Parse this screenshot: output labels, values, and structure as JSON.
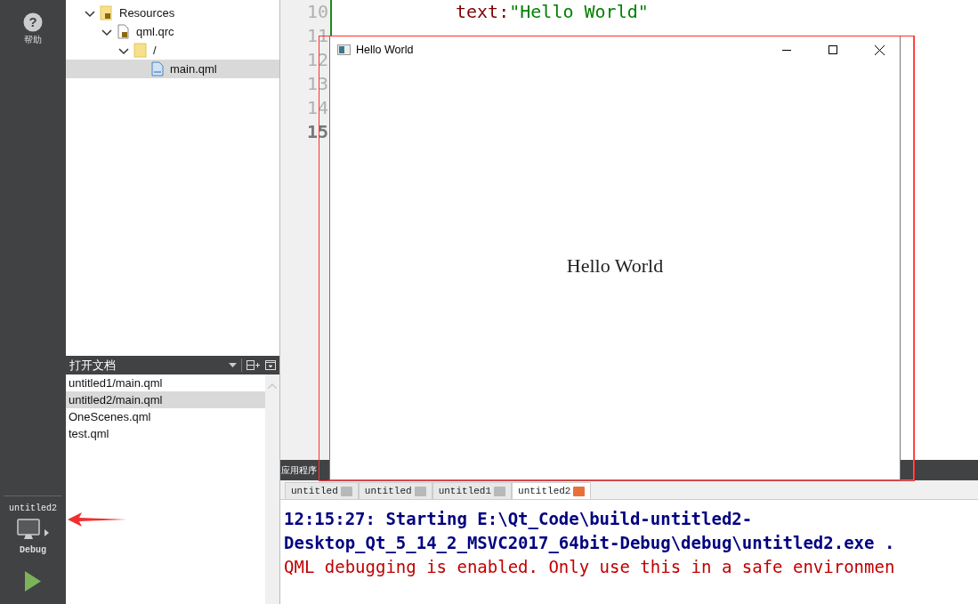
{
  "sidebar": {
    "help_icon": "?",
    "help_label": "帮助",
    "project": "untitled2",
    "build_config": "Debug"
  },
  "project_tree": [
    {
      "label": "Resources",
      "kind": "resfolder",
      "expanded": true,
      "selected": false,
      "children": [
        {
          "label": "qml.qrc",
          "kind": "qrc",
          "expanded": true,
          "selected": false,
          "children": [
            {
              "label": "/",
              "kind": "folder",
              "expanded": true,
              "selected": false,
              "children": [
                {
                  "label": "main.qml",
                  "kind": "qml",
                  "selected": true
                }
              ]
            }
          ]
        }
      ]
    }
  ],
  "open_documents": {
    "title": "打开文档",
    "items": [
      {
        "label": "untitled1/main.qml",
        "selected": false
      },
      {
        "label": "untitled2/main.qml",
        "selected": true
      },
      {
        "label": "OneScenes.qml",
        "selected": false
      },
      {
        "label": "test.qml",
        "selected": false
      }
    ]
  },
  "editor": {
    "lines": [
      {
        "number": "10",
        "current": false,
        "parts": [
          {
            "kind": "prop",
            "text": "text:"
          },
          {
            "kind": "string",
            "text": "\"Hello World\""
          }
        ]
      },
      {
        "number": "11",
        "current": false
      },
      {
        "number": "12",
        "current": false
      },
      {
        "number": "13",
        "current": false
      },
      {
        "number": "14",
        "current": false
      },
      {
        "number": "15",
        "current": true
      }
    ]
  },
  "output": {
    "title": "应用程序",
    "tabs": [
      {
        "label": "untitled",
        "selected": false
      },
      {
        "label": "untitled",
        "selected": false
      },
      {
        "label": "untitled1",
        "selected": false
      },
      {
        "label": "untitled2",
        "selected": true
      }
    ],
    "lines": [
      {
        "kind": "info",
        "text": "12:15:27: Starting E:\\Qt_Code\\build-untitled2-"
      },
      {
        "kind": "info",
        "text": "Desktop_Qt_5_14_2_MSVC2017_64bit-Debug\\debug\\untitled2.exe ."
      },
      {
        "kind": "error",
        "text": "QML debugging is enabled. Only use this in a safe environmen"
      }
    ]
  },
  "app_window": {
    "title": "Hello World",
    "content": "Hello World"
  }
}
